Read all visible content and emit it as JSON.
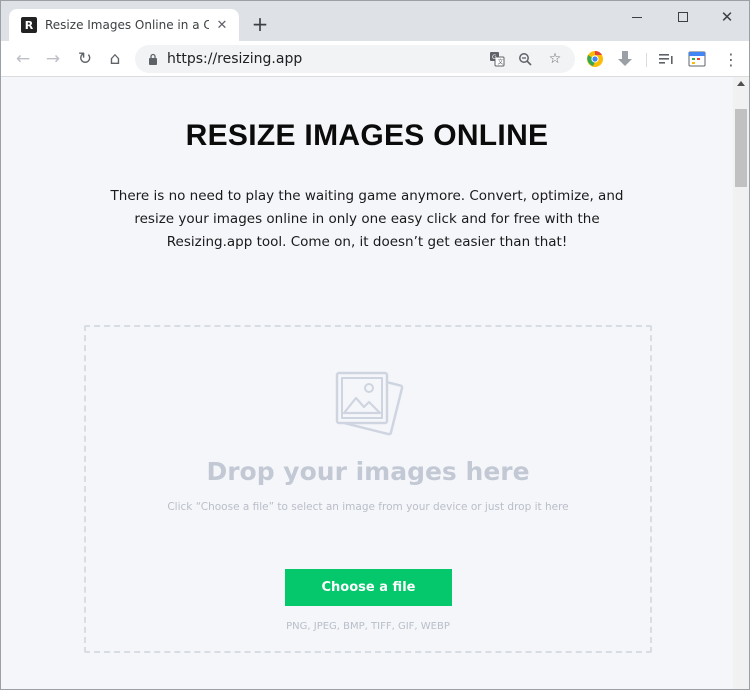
{
  "browser": {
    "tab": {
      "favicon_letter": "R",
      "title": "Resize Images Online in a Click",
      "close_glyph": "✕"
    },
    "new_tab_glyph": "+",
    "window_controls": {
      "close_glyph": "✕"
    },
    "toolbar": {
      "back_glyph": "←",
      "forward_glyph": "→",
      "reload_glyph": "↻",
      "home_glyph": "⌂",
      "url": "https://resizing.app",
      "star_glyph": "☆",
      "menu_glyph": "⋮"
    }
  },
  "page": {
    "title": "RESIZE IMAGES ONLINE",
    "intro": "There is no need to play the waiting game anymore. Convert, optimize, and resize your images online in only one easy click and for free with the Resizing.app tool. Come on, it doesn’t get easier than that!",
    "dropzone": {
      "icon": "images-icon",
      "title": "Drop your images here",
      "subtitle": "Click “Choose a file” to select an image from your device or just drop it here",
      "button_label": "Choose a file",
      "formats": "PNG, JPEG, BMP, TIFF, GIF, WEBP"
    }
  },
  "colors": {
    "accent": "#05c76c",
    "page_bg": "#f5f6fa",
    "dropzone_text": "#c3c9d4"
  }
}
